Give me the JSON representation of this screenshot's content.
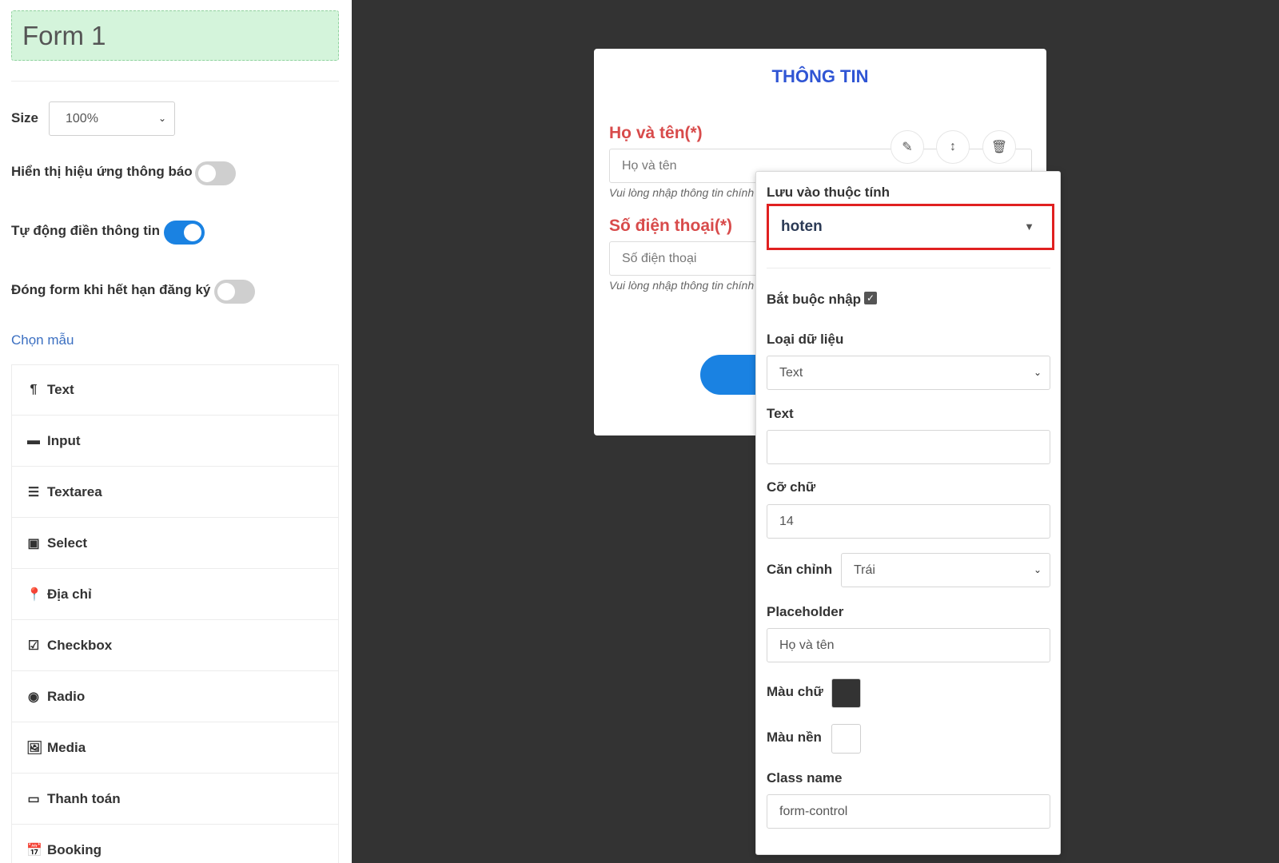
{
  "sidebar": {
    "form_name": "Form 1",
    "size_label": "Size",
    "size_value": "100%",
    "options": [
      {
        "label": "Hiển thị hiệu ứng thông báo",
        "enabled": false
      },
      {
        "label": "Tự động điền thông tin",
        "enabled": true
      },
      {
        "label": "Đóng form khi hết hạn đăng ký",
        "enabled": false
      }
    ],
    "choose_template": "Chọn mẫu",
    "elements": [
      {
        "label": "Text",
        "icon": "¶"
      },
      {
        "label": "Input",
        "icon": "▬"
      },
      {
        "label": "Textarea",
        "icon": "☰"
      },
      {
        "label": "Select",
        "icon": "▣"
      },
      {
        "label": "Địa chỉ",
        "icon": "📍"
      },
      {
        "label": "Checkbox",
        "icon": "☑"
      },
      {
        "label": "Radio",
        "icon": "◉"
      },
      {
        "label": "Media",
        "icon": "🖼"
      },
      {
        "label": "Thanh toán",
        "icon": "▭"
      },
      {
        "label": "Booking",
        "icon": "📅"
      }
    ]
  },
  "form": {
    "title": "THÔNG TIN",
    "fields": [
      {
        "label": "Họ và tên(*)",
        "placeholder": "Họ và tên",
        "hint": "Vui lòng nhập thông tin chính"
      },
      {
        "label": "Số điện thoại(*)",
        "placeholder": "Số điện thoại",
        "hint": "Vui lòng nhập thông tin chính"
      }
    ],
    "tools": {
      "edit": "✎",
      "move": "↕",
      "delete": "🗑"
    }
  },
  "props": {
    "attr_label": "Lưu vào thuộc tính",
    "attr_value": "hoten",
    "required_label": "Bắt buộc nhập",
    "datatype_label": "Loại dữ liệu",
    "datatype_value": "Text",
    "text_label": "Text",
    "text_value": "",
    "fontsize_label": "Cỡ chữ",
    "fontsize_value": "14",
    "align_label": "Căn chỉnh",
    "align_value": "Trái",
    "placeholder_label": "Placeholder",
    "placeholder_value": "Họ và tên",
    "textcolor_label": "Màu chữ",
    "textcolor": "#333333",
    "bgcolor_label": "Màu nền",
    "bgcolor": "#ffffff",
    "classname_label": "Class name",
    "classname_value": "form-control"
  }
}
